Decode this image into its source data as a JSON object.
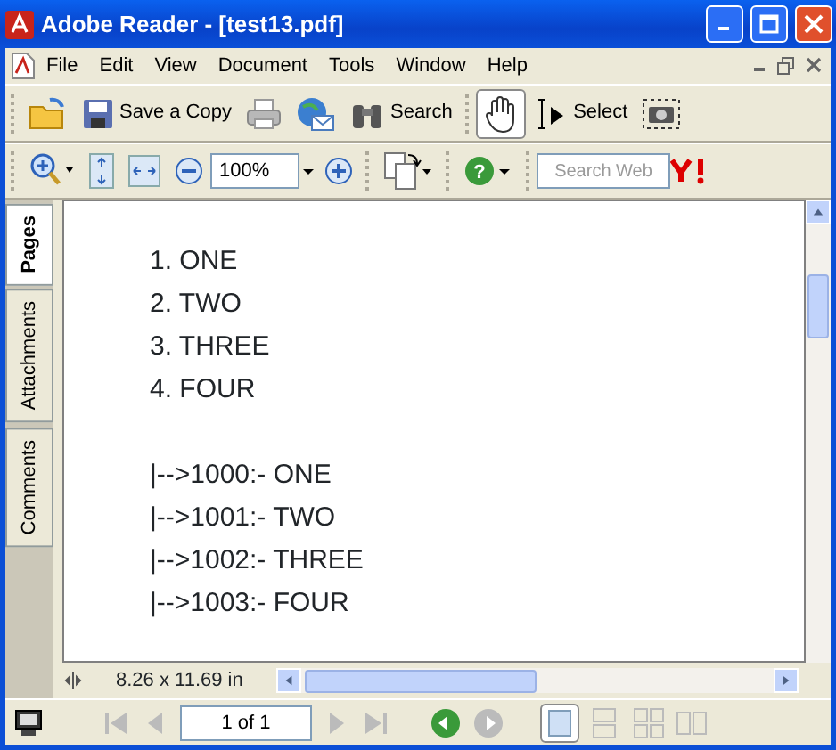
{
  "window": {
    "title": "Adobe Reader - [test13.pdf]"
  },
  "menu": [
    "File",
    "Edit",
    "View",
    "Document",
    "Tools",
    "Window",
    "Help"
  ],
  "toolbar": {
    "save_label": "Save a Copy",
    "search_label": "Search",
    "hand_selected": true,
    "select_label": "Select",
    "select_selected": false
  },
  "zoom_toolbar": {
    "zoom_value": "100%",
    "search_web_placeholder": "Search Web",
    "help_glyph": "?"
  },
  "side_tabs": [
    {
      "label": "Pages",
      "selected": true
    },
    {
      "label": "Attachments",
      "selected": false
    },
    {
      "label": "Comments",
      "selected": false
    }
  ],
  "document": {
    "list": [
      "1. ONE",
      "2. TWO",
      "3. THREE",
      "4. FOUR"
    ],
    "mapping": [
      "|-->1000:- ONE",
      "|-->1001:- TWO",
      "|-->1002:- THREE",
      "|-->1003:- FOUR"
    ]
  },
  "page_size": "8.26 x 11.69 in",
  "page_field": "1 of 1",
  "views": [
    {
      "selected": true
    },
    {
      "selected": false
    },
    {
      "selected": false
    },
    {
      "selected": false
    }
  ]
}
